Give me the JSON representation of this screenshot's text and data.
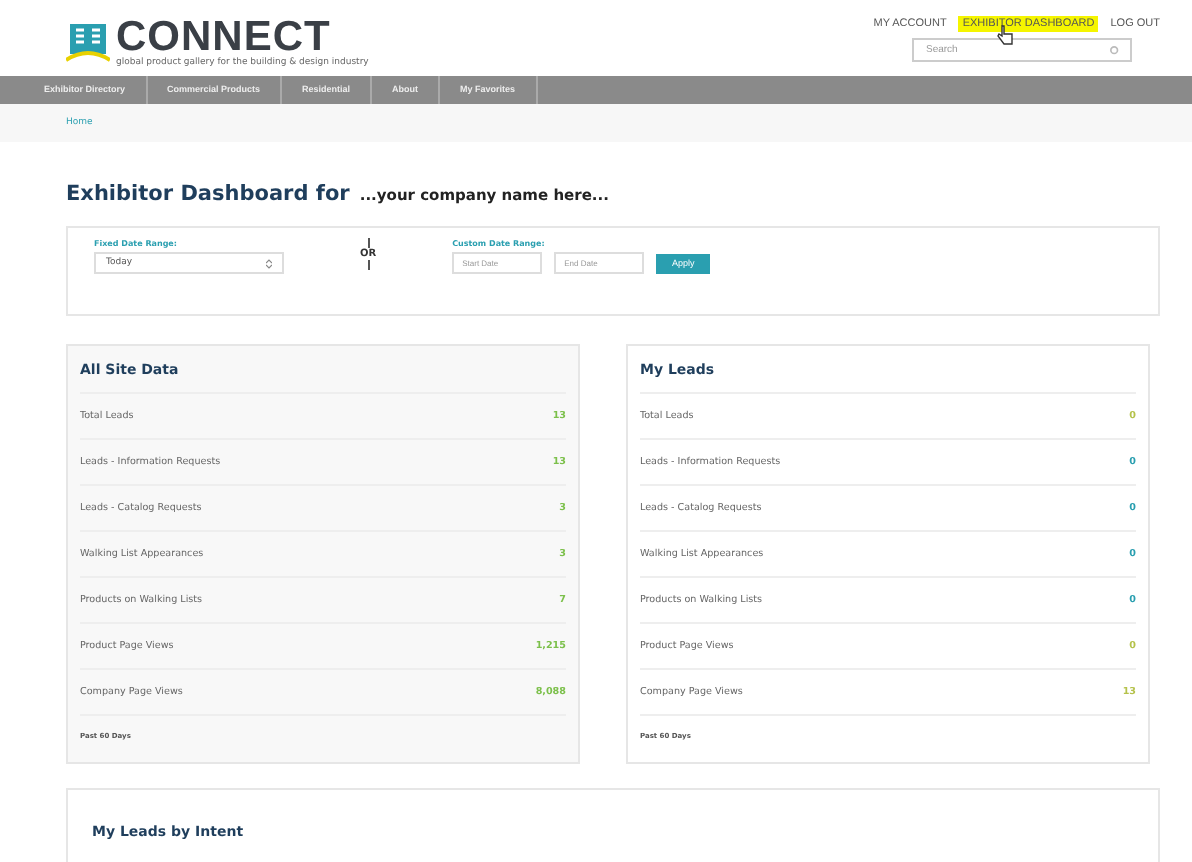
{
  "logo": {
    "name": "CONNECT",
    "tagline": "global product gallery for the building & design industry"
  },
  "top_links": [
    {
      "label": "MY ACCOUNT",
      "selected": false
    },
    {
      "label": "EXHIBITOR DASHBOARD",
      "selected": true
    },
    {
      "label": "LOG OUT",
      "selected": false
    }
  ],
  "search": {
    "placeholder": "Search"
  },
  "nav": [
    "Exhibitor Directory",
    "Commercial Products",
    "Residential",
    "About",
    "My Favorites"
  ],
  "breadcrumb": "Home",
  "title": {
    "heading": "Exhibitor Dashboard for",
    "company": "...your company name here..."
  },
  "filters": {
    "fixed_label": "Fixed Date Range:",
    "fixed_value": "Today",
    "or": "OR",
    "custom_label": "Custom Date Range:",
    "start_placeholder": "Start Date",
    "end_placeholder": "End Date",
    "apply": "Apply"
  },
  "panels": [
    {
      "title": "All Site Data",
      "footer": "Past 60 Days",
      "rows": [
        {
          "label": "Total Leads",
          "value": "13",
          "color": "#7cc04b"
        },
        {
          "label": "Leads - Information Requests",
          "value": "13",
          "color": "#7cc04b"
        },
        {
          "label": "Leads - Catalog Requests",
          "value": "3",
          "color": "#7cc04b"
        },
        {
          "label": "Walking List Appearances",
          "value": "3",
          "color": "#7cc04b"
        },
        {
          "label": "Products on Walking Lists",
          "value": "7",
          "color": "#7cc04b"
        },
        {
          "label": "Product Page Views",
          "value": "1,215",
          "color": "#7cc04b"
        },
        {
          "label": "Company Page Views",
          "value": "8,088",
          "color": "#7cc04b"
        }
      ]
    },
    {
      "title": "My Leads",
      "footer": "Past 60 Days",
      "rows": [
        {
          "label": "Total Leads",
          "value": "0",
          "color": "#b5c24b"
        },
        {
          "label": "Leads - Information Requests",
          "value": "0",
          "color": "#2a9fb0"
        },
        {
          "label": "Leads - Catalog Requests",
          "value": "0",
          "color": "#2a9fb0"
        },
        {
          "label": "Walking List Appearances",
          "value": "0",
          "color": "#2a9fb0"
        },
        {
          "label": "Products on Walking Lists",
          "value": "0",
          "color": "#2a9fb0"
        },
        {
          "label": "Product Page Views",
          "value": "0",
          "color": "#b5c24b"
        },
        {
          "label": "Company Page Views",
          "value": "13",
          "color": "#b5c24b"
        }
      ]
    }
  ],
  "intent": {
    "title": "My Leads by Intent"
  }
}
